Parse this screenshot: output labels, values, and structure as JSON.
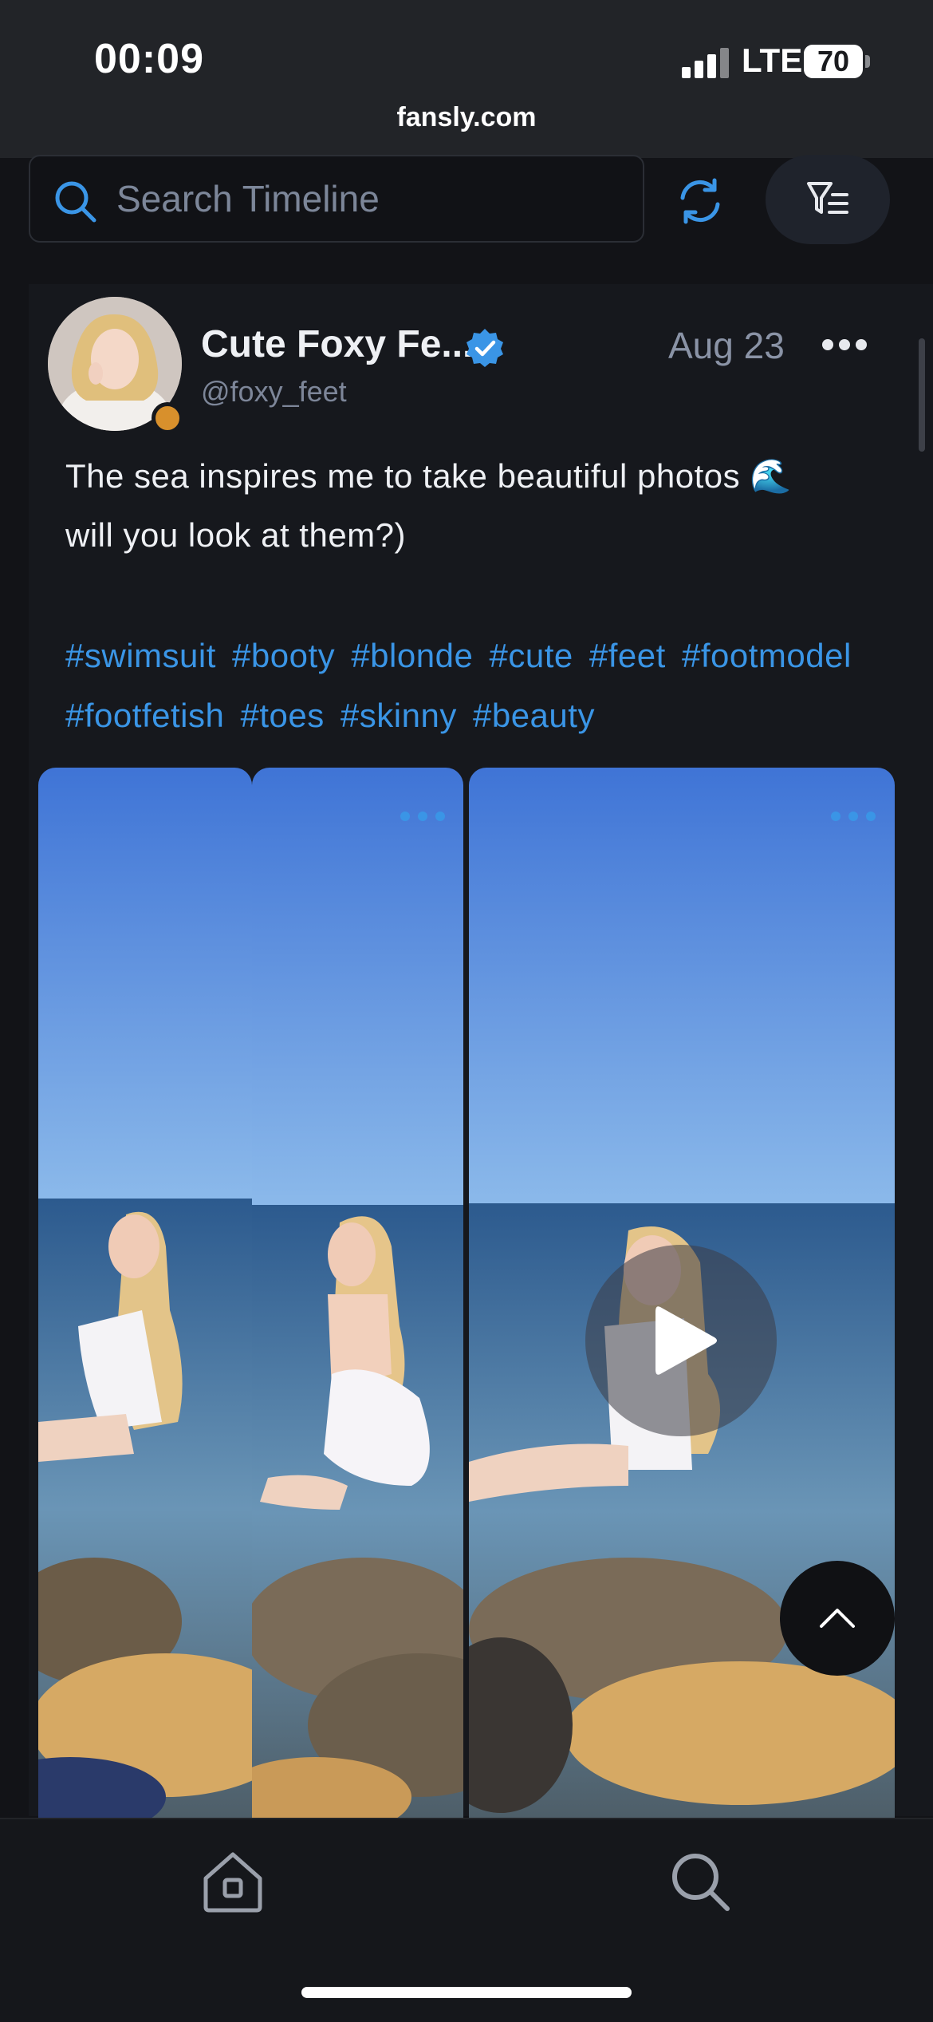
{
  "status_bar": {
    "time": "00:09",
    "network": "LTE",
    "battery": "70",
    "url": "fansly.com"
  },
  "search": {
    "placeholder": "Search Timeline"
  },
  "icons": {
    "search": "search-icon",
    "refresh": "refresh-icon",
    "filter": "filter-icon",
    "verified": "verified-badge-icon",
    "more": "more-icon",
    "play": "play-icon",
    "scroll_top": "chevron-up-icon",
    "home": "home-icon",
    "nav_search": "search-icon"
  },
  "colors": {
    "accent": "#3a95e6",
    "background": "#121317",
    "card": "#16181d",
    "online": "#d8902c"
  },
  "post": {
    "display_name": "Cute Foxy Fe...",
    "username": "@foxy_feet",
    "date": "Aug 23",
    "text_line1": "The sea inspires me to take beautiful photos 🌊",
    "text_line2": "will you look at them?)",
    "hashtags": [
      "#swimsuit",
      "#booty",
      "#blonde",
      "#cute",
      "#feet",
      "#footmodel",
      "#footfetish",
      "#toes",
      "#skinny",
      "#beauty"
    ],
    "media": [
      {
        "type": "photo",
        "label": "media-photo-1"
      },
      {
        "type": "photo",
        "label": "media-photo-2"
      },
      {
        "type": "video",
        "label": "media-video-3"
      }
    ]
  }
}
